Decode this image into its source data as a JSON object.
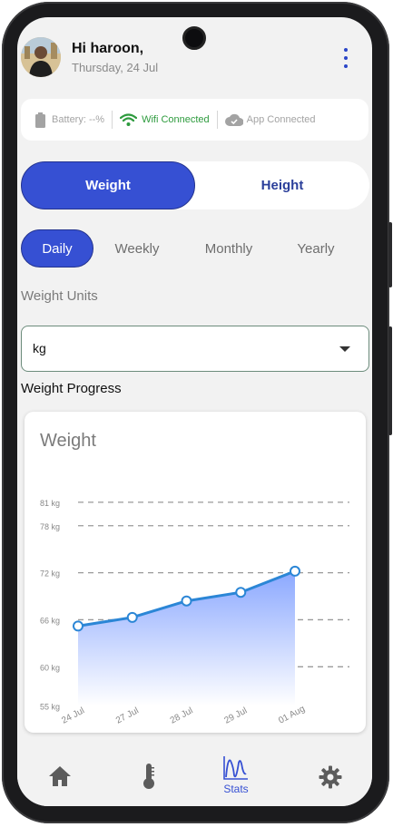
{
  "header": {
    "greeting": "Hi haroon,",
    "date": "Thursday, 24 Jul"
  },
  "status": {
    "battery": "Battery: --%",
    "wifi": "Wifi Connected",
    "app": "App Connected",
    "colors": {
      "wifi": "#2e9b3e",
      "muted": "#a3a3a3"
    }
  },
  "metric_toggle": {
    "options": [
      "Weight",
      "Height"
    ],
    "selected": "Weight"
  },
  "periods": {
    "options": [
      "Daily",
      "Weekly",
      "Monthly",
      "Yearly"
    ],
    "selected": "Daily"
  },
  "units": {
    "label": "Weight Units",
    "value": "kg"
  },
  "progress": {
    "label": "Weight Progress"
  },
  "chart_data": {
    "type": "area",
    "title": "Weight",
    "categories": [
      "24 Jul",
      "27 Jul",
      "28 Jul",
      "29 Jul",
      "01 Aug"
    ],
    "series": [
      {
        "values": [
          65.2,
          66.3,
          68.4,
          69.5,
          72.2
        ]
      }
    ],
    "y_ticks": [
      "55 kg",
      "60 kg",
      "66 kg",
      "72 kg",
      "78 kg",
      "81 kg"
    ],
    "y_tick_values": [
      55,
      60,
      66,
      72,
      78,
      81
    ],
    "ylim": [
      55,
      81
    ],
    "grid": true,
    "colors": {
      "line": "#2b86d6",
      "fill_top": "#8ba8ff",
      "fill_bottom": "#ffffff"
    }
  },
  "bottom_nav": {
    "items": [
      {
        "icon": "home-icon",
        "label": ""
      },
      {
        "icon": "thermometer-icon",
        "label": ""
      },
      {
        "icon": "stats-icon",
        "label": "Stats"
      },
      {
        "icon": "gear-icon",
        "label": ""
      }
    ],
    "active": "Stats",
    "accent": "#3650d3"
  }
}
